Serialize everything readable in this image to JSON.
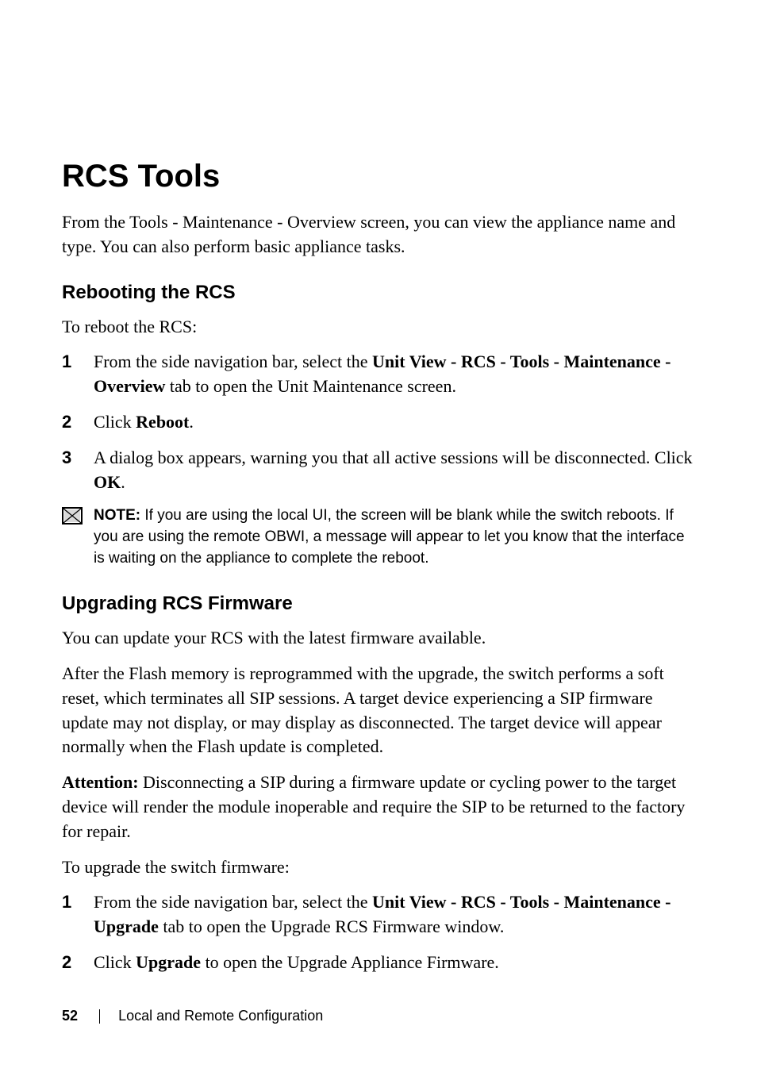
{
  "heading": "RCS Tools",
  "intro": "From the Tools - Maintenance - Overview screen, you can view the appliance name and type. You can also perform basic appliance tasks.",
  "section1": {
    "heading": "Rebooting the RCS",
    "intro": "To reboot the RCS:",
    "step1_pre": "From the side navigation bar, select the ",
    "step1_bold": "Unit View - RCS - Tools - Maintenance - Overview",
    "step1_post": " tab to open the Unit Maintenance screen.",
    "step2_pre": "Click ",
    "step2_bold": "Reboot",
    "step2_post": ".",
    "step3_pre": "A dialog box appears, warning you that all active sessions will be disconnected. Click ",
    "step3_bold": "OK",
    "step3_post": ".",
    "note_label": "NOTE:",
    "note_text": " If you are using the local UI, the screen will be blank while the switch reboots. If you are using the remote OBWI, a message will appear to let you know that the interface is waiting on the appliance to complete the reboot."
  },
  "section2": {
    "heading": "Upgrading RCS Firmware",
    "intro": "You can update your RCS with the latest firmware available.",
    "para2": "After the Flash memory is reprogrammed with the upgrade, the switch performs a soft reset, which terminates all SIP sessions. A target device experiencing a SIP firmware update may not display, or may display as disconnected. The target device will appear normally when the Flash update is completed.",
    "attention_label": "Attention:",
    "attention_text": " Disconnecting a SIP during a firmware update or cycling power to the target device will render the module inoperable and require the SIP to be returned to the factory for repair.",
    "para4": "To upgrade the switch firmware:",
    "step1_pre": "From the side navigation bar, select the  ",
    "step1_bold": "Unit View - RCS - Tools - Maintenance - Upgrade",
    "step1_post": " tab to open the Upgrade RCS Firmware window.",
    "step2_pre": "Click ",
    "step2_bold": "Upgrade",
    "step2_post": " to open the Upgrade Appliance Firmware."
  },
  "list_numbers": {
    "n1": "1",
    "n2": "2",
    "n3": "3"
  },
  "footer": {
    "page": "52",
    "title": "Local and Remote Configuration"
  }
}
